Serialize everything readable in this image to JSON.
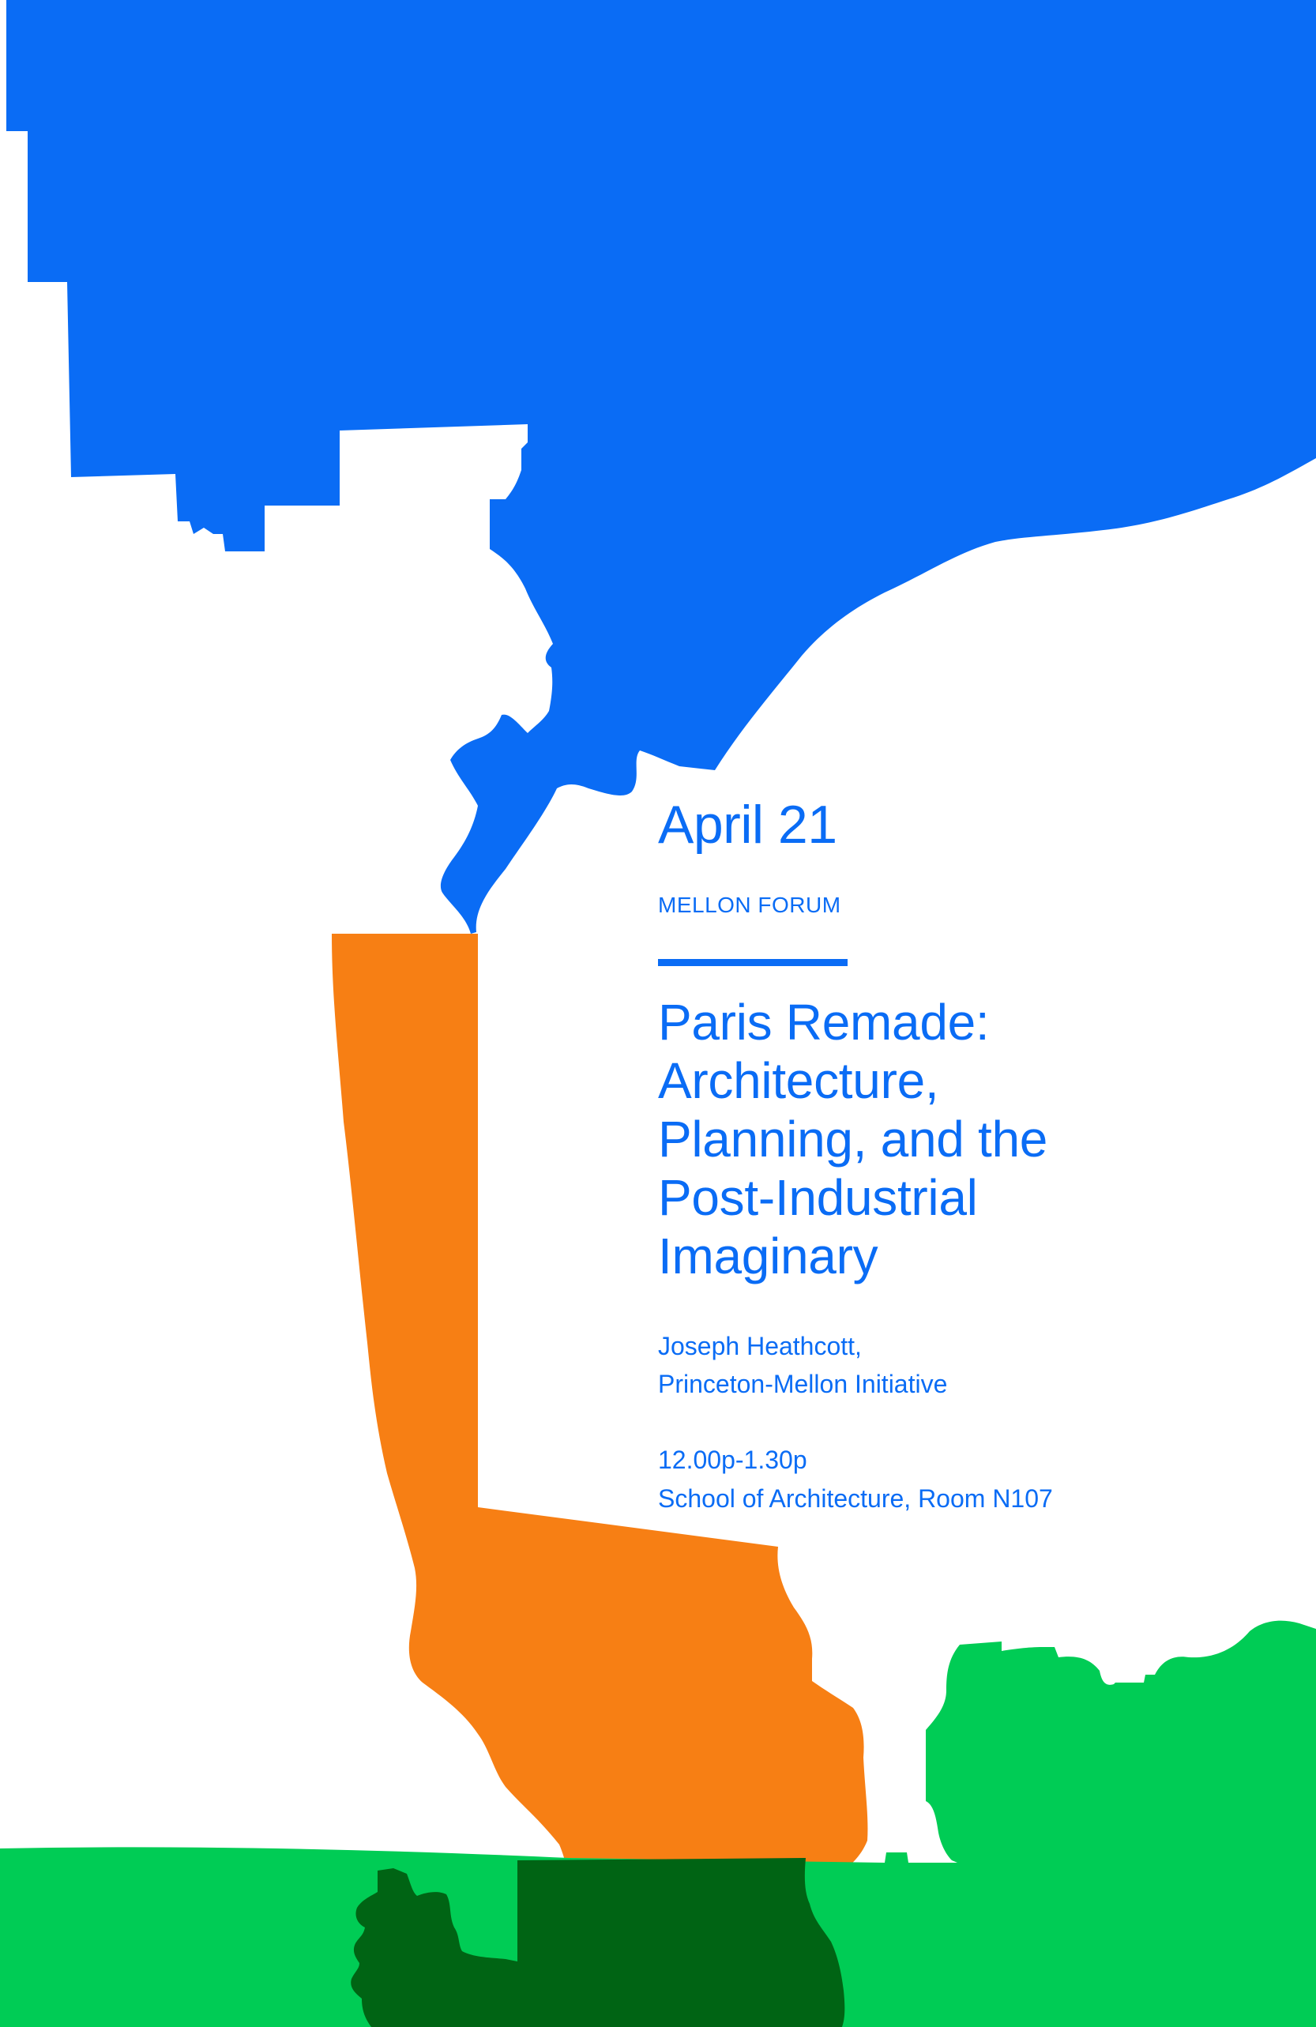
{
  "poster": {
    "date": "April 21",
    "series": "MELLON FORUM",
    "title_lines": [
      "Paris Remade:",
      "Architecture,",
      "Planning, and the",
      "Post-Industrial",
      "Imaginary"
    ],
    "speaker_lines": [
      "Joseph Heathcott,",
      "Princeton-Mellon Initiative"
    ],
    "detail_lines": [
      "12.00p-1.30p",
      "School of Architecture, Room N107"
    ]
  },
  "colors": {
    "background": "#ffffff",
    "blue": "#0a6cf5",
    "orange": "#f77f14",
    "light_green": "#00cc55",
    "dark_green": "#006414"
  }
}
